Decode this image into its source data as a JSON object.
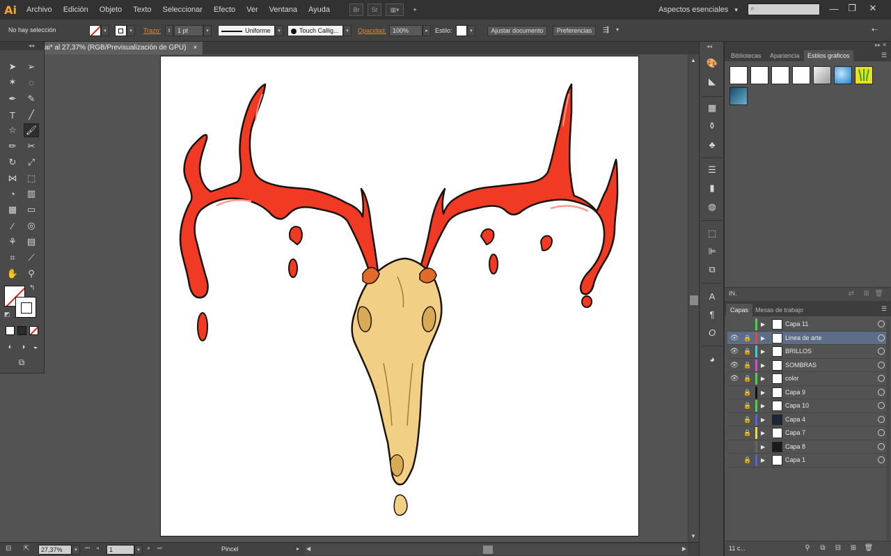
{
  "app": {
    "logo": "Ai"
  },
  "menus": [
    "Archivo",
    "Edición",
    "Objeto",
    "Texto",
    "Seleccionar",
    "Efecto",
    "Ver",
    "Ventana",
    "Ayuda"
  ],
  "menubar_icons": [
    "Br",
    "St",
    "▦▾",
    "✦"
  ],
  "workspace": {
    "label": "Aspectos esenciales",
    "arrow": "▾"
  },
  "search": {
    "placeholder": ""
  },
  "window_controls": {
    "minimize": "—",
    "restore": "❐",
    "close": "✕"
  },
  "control_bar": {
    "selection": "No hay selección",
    "stroke_label": "Trazo:",
    "stroke_weight": "1 pt",
    "profile": "Uniforme",
    "brush": "Touch Callig...",
    "opacity_label": "Opacidad:",
    "opacity": "100%",
    "style_label": "Estilo:",
    "document_btn": "Ajustar documento",
    "prefs_btn": "Preferencias"
  },
  "document": {
    "tab_title": "ai* al 27,37% (RGB/Previsualización de GPU)",
    "close": "×"
  },
  "status": {
    "zoom": "27,37%",
    "artboard": "1",
    "tool": "Pincel"
  },
  "graphic_styles_panel": {
    "tabs": [
      "Bibliotecas",
      "Apariencia",
      "Estilos gráficos"
    ],
    "active_tab": "Estilos gráficos",
    "footer_icon": "IN."
  },
  "layers_panel": {
    "tabs": [
      "Capas",
      "Mesas de trabajo"
    ],
    "active_tab": "Capas",
    "count": "11 c...",
    "layers": [
      {
        "name": "Capa 11",
        "visible": false,
        "locked": false,
        "color": "#4bd44b",
        "thumb": "#ffffff",
        "selected": false
      },
      {
        "name": "Linea de arte",
        "visible": true,
        "locked": true,
        "color": "#e04848",
        "thumb": "#ffffff",
        "selected": true
      },
      {
        "name": "BRILLOS",
        "visible": true,
        "locked": true,
        "color": "#46c8d8",
        "thumb": "#ffffff",
        "selected": false
      },
      {
        "name": "SOMBRAS",
        "visible": true,
        "locked": true,
        "color": "#d04ed8",
        "thumb": "#ffffff",
        "selected": false
      },
      {
        "name": "color",
        "visible": true,
        "locked": true,
        "color": "#4bd44b",
        "thumb": "#ffffff",
        "selected": false
      },
      {
        "name": "Capa 9",
        "visible": false,
        "locked": true,
        "color": "#111111",
        "thumb": "#ffffff",
        "selected": false
      },
      {
        "name": "Capa 10",
        "visible": false,
        "locked": true,
        "color": "#4bd44b",
        "thumb": "#ffffff",
        "selected": false
      },
      {
        "name": "Capa 4",
        "visible": false,
        "locked": true,
        "color": "#5566dd",
        "thumb": "#1b2538",
        "selected": false
      },
      {
        "name": "Capa 7",
        "visible": false,
        "locked": true,
        "color": "#e8e040",
        "thumb": "#ffffff",
        "selected": false
      },
      {
        "name": "Capa 8",
        "visible": false,
        "locked": false,
        "color": "#666666",
        "thumb": "#1a1a1a",
        "selected": false
      },
      {
        "name": "Capa 1",
        "visible": false,
        "locked": true,
        "color": "#5566dd",
        "thumb": "#ffffff",
        "selected": false
      }
    ]
  },
  "colors": {
    "antler": "#f03a24",
    "antler_dark": "#c81e10",
    "skull": "#f1cf85",
    "skull_shade": "#d9aa55",
    "outline": "#1a1208"
  }
}
